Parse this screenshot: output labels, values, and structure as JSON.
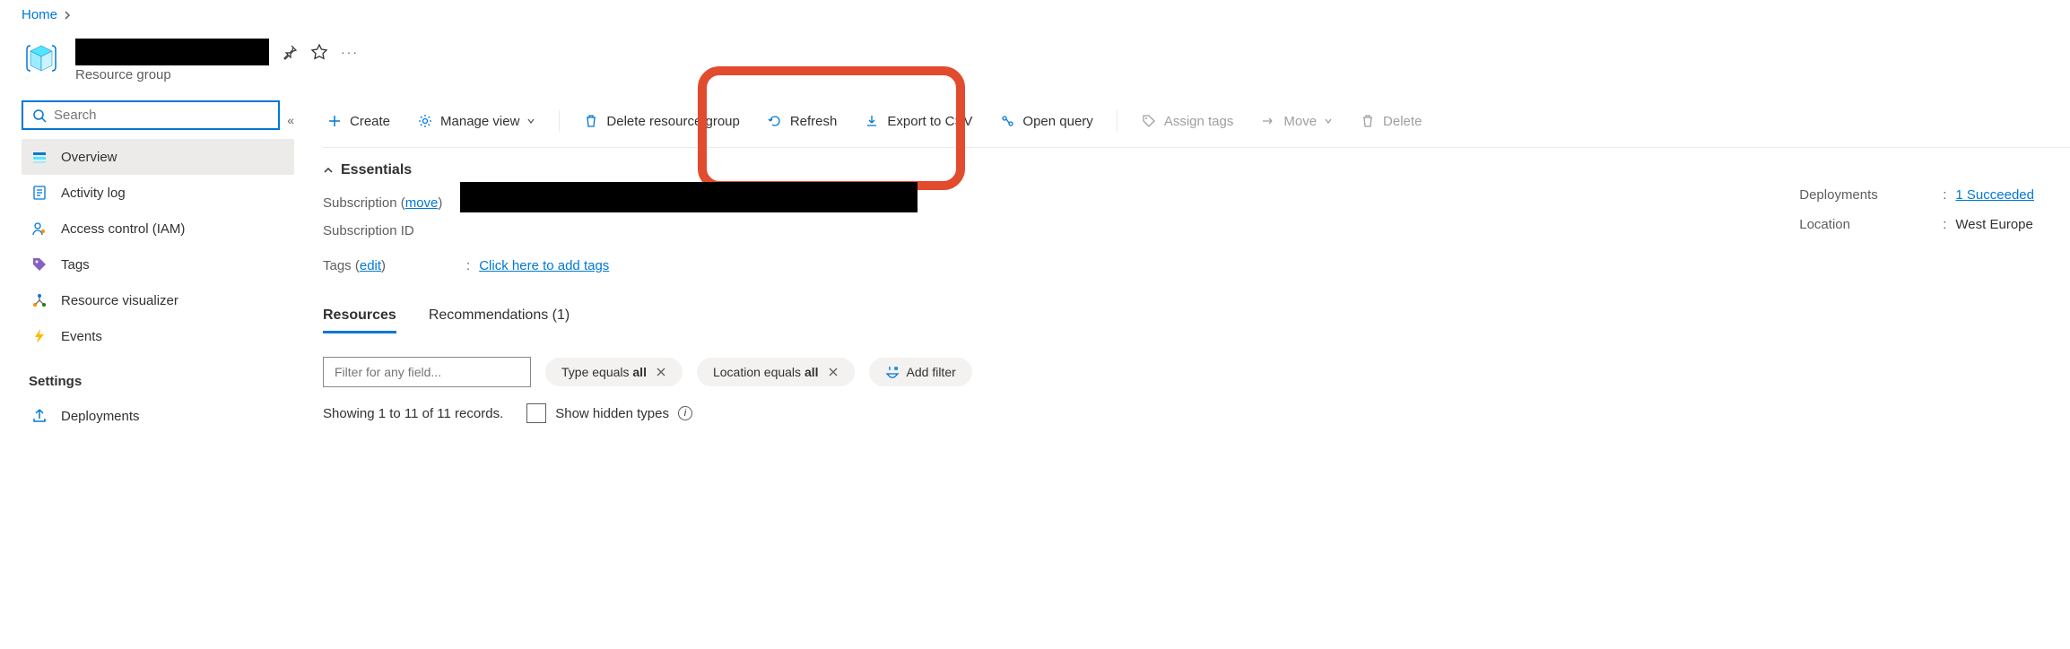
{
  "breadcrumb": {
    "home": "Home"
  },
  "header": {
    "subtitle": "Resource group"
  },
  "search": {
    "placeholder": "Search"
  },
  "nav": {
    "items": [
      {
        "label": "Overview"
      },
      {
        "label": "Activity log"
      },
      {
        "label": "Access control (IAM)"
      },
      {
        "label": "Tags"
      },
      {
        "label": "Resource visualizer"
      },
      {
        "label": "Events"
      }
    ],
    "section_settings": "Settings",
    "deployments": "Deployments"
  },
  "toolbar": {
    "create": "Create",
    "manage_view": "Manage view",
    "delete_rg": "Delete resource group",
    "refresh": "Refresh",
    "export_csv": "Export to CSV",
    "open_query": "Open query",
    "assign_tags": "Assign tags",
    "move": "Move",
    "delete": "Delete"
  },
  "essentials": {
    "title": "Essentials",
    "subscription_label": "Subscription (",
    "subscription_move": "move",
    "subscription_label_end": ")",
    "subscription_id_label": "Subscription ID",
    "tags_label": "Tags (",
    "tags_edit": "edit",
    "tags_label_end": ")",
    "tags_link": "Click here to add tags",
    "deployments_label": "Deployments",
    "deployments_value": "1 Succeeded",
    "location_label": "Location",
    "location_value": "West Europe"
  },
  "tabs": {
    "resources": "Resources",
    "recommendations": "Recommendations (1)"
  },
  "filters": {
    "placeholder": "Filter for any field...",
    "type_prefix": "Type equals ",
    "type_val": "all",
    "location_prefix": "Location equals ",
    "location_val": "all",
    "add_filter": "Add filter"
  },
  "records": {
    "showing": "Showing 1 to 11 of 11 records.",
    "hidden_types": "Show hidden types"
  }
}
